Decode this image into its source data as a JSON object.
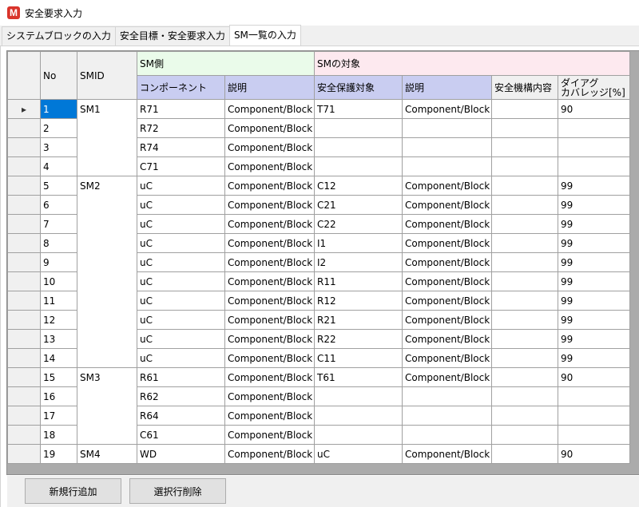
{
  "window": {
    "title": "安全要求入力"
  },
  "tabs": [
    {
      "label": "システムブロックの入力"
    },
    {
      "label": "安全目標・安全要求入力"
    },
    {
      "label": "SM一覧の入力"
    }
  ],
  "grid": {
    "headers": {
      "no": "No",
      "smid": "SMID",
      "sm_side": "SM側",
      "sm_target": "SMの対象",
      "component": "コンポーネント",
      "description": "説明",
      "safety_target": "安全保護対象",
      "description2": "説明",
      "safety_mechanism": "安全機構内容",
      "diag_line1": "ダイアグ",
      "diag_line2": "カバレッジ[%]"
    },
    "current_row_marker": "▸",
    "rows": [
      {
        "no": "1",
        "smid": "SM1",
        "comp": "R71",
        "desc": "Component/Block",
        "target": "T71",
        "desc2": "Component/Block",
        "mech": "",
        "diag": "90"
      },
      {
        "no": "2",
        "smid": "",
        "comp": "R72",
        "desc": "Component/Block",
        "target": "",
        "desc2": "",
        "mech": "",
        "diag": ""
      },
      {
        "no": "3",
        "smid": "",
        "comp": "R74",
        "desc": "Component/Block",
        "target": "",
        "desc2": "",
        "mech": "",
        "diag": ""
      },
      {
        "no": "4",
        "smid": "",
        "comp": "C71",
        "desc": "Component/Block",
        "target": "",
        "desc2": "",
        "mech": "",
        "diag": ""
      },
      {
        "no": "5",
        "smid": "SM2",
        "comp": "uC",
        "desc": "Component/Block",
        "target": "C12",
        "desc2": "Component/Block",
        "mech": "",
        "diag": "99"
      },
      {
        "no": "6",
        "smid": "",
        "comp": "uC",
        "desc": "Component/Block",
        "target": "C21",
        "desc2": "Component/Block",
        "mech": "",
        "diag": "99"
      },
      {
        "no": "7",
        "smid": "",
        "comp": "uC",
        "desc": "Component/Block",
        "target": "C22",
        "desc2": "Component/Block",
        "mech": "",
        "diag": "99"
      },
      {
        "no": "8",
        "smid": "",
        "comp": "uC",
        "desc": "Component/Block",
        "target": "I1",
        "desc2": "Component/Block",
        "mech": "",
        "diag": "99"
      },
      {
        "no": "9",
        "smid": "",
        "comp": "uC",
        "desc": "Component/Block",
        "target": "I2",
        "desc2": "Component/Block",
        "mech": "",
        "diag": "99"
      },
      {
        "no": "10",
        "smid": "",
        "comp": "uC",
        "desc": "Component/Block",
        "target": "R11",
        "desc2": "Component/Block",
        "mech": "",
        "diag": "99"
      },
      {
        "no": "11",
        "smid": "",
        "comp": "uC",
        "desc": "Component/Block",
        "target": "R12",
        "desc2": "Component/Block",
        "mech": "",
        "diag": "99"
      },
      {
        "no": "12",
        "smid": "",
        "comp": "uC",
        "desc": "Component/Block",
        "target": "R21",
        "desc2": "Component/Block",
        "mech": "",
        "diag": "99"
      },
      {
        "no": "13",
        "smid": "",
        "comp": "uC",
        "desc": "Component/Block",
        "target": "R22",
        "desc2": "Component/Block",
        "mech": "",
        "diag": "99"
      },
      {
        "no": "14",
        "smid": "",
        "comp": "uC",
        "desc": "Component/Block",
        "target": "C11",
        "desc2": "Component/Block",
        "mech": "",
        "diag": "99"
      },
      {
        "no": "15",
        "smid": "SM3",
        "comp": "R61",
        "desc": "Component/Block",
        "target": "T61",
        "desc2": "Component/Block",
        "mech": "",
        "diag": "90"
      },
      {
        "no": "16",
        "smid": "",
        "comp": "R62",
        "desc": "Component/Block",
        "target": "",
        "desc2": "",
        "mech": "",
        "diag": ""
      },
      {
        "no": "17",
        "smid": "",
        "comp": "R64",
        "desc": "Component/Block",
        "target": "",
        "desc2": "",
        "mech": "",
        "diag": ""
      },
      {
        "no": "18",
        "smid": "",
        "comp": "C61",
        "desc": "Component/Block",
        "target": "",
        "desc2": "",
        "mech": "",
        "diag": ""
      },
      {
        "no": "19",
        "smid": "SM4",
        "comp": "WD",
        "desc": "Component/Block",
        "target": "uC",
        "desc2": "Component/Block",
        "mech": "",
        "diag": "90"
      }
    ]
  },
  "buttons": {
    "add_row": "新規行追加",
    "delete_row": "選択行削除"
  }
}
